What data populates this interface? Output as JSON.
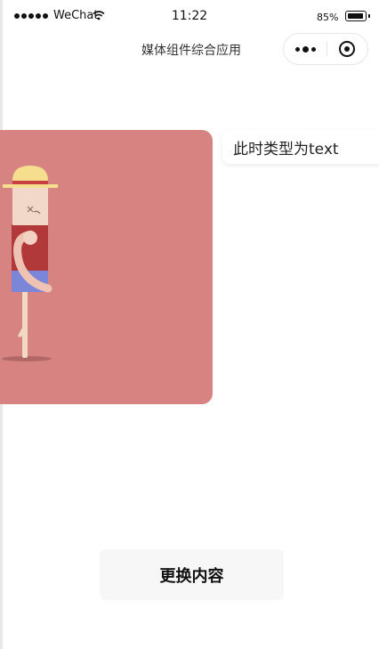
{
  "status_bar": {
    "carrier": "WeChat",
    "time": "11:22",
    "battery": "85%",
    "battery_level": 0.85
  },
  "nav": {
    "title": "媒体组件综合应用",
    "more_icon": "more-dots-icon",
    "close_icon": "mini-program-close-icon"
  },
  "content": {
    "image_card": {
      "background_color": "#d78382",
      "description": "illustration"
    },
    "type_label": "此时类型为text"
  },
  "actions": {
    "change_label": "更换内容"
  }
}
